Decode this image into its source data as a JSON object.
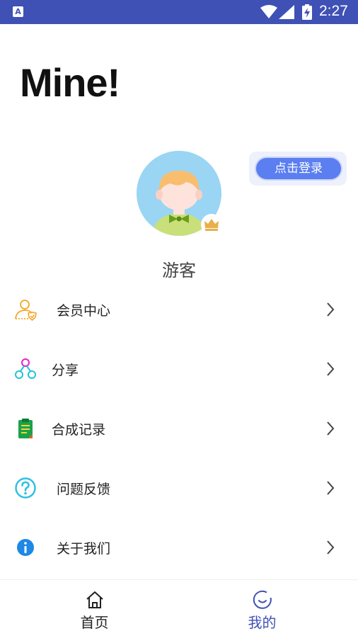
{
  "status_bar": {
    "app_icon": "A",
    "time": "2:27",
    "icons": [
      "wifi-icon",
      "signal-icon",
      "battery-charging-icon"
    ],
    "color": "#3f51b5"
  },
  "header": {
    "title": "Mine!"
  },
  "profile": {
    "login_label": "点击登录",
    "username": "游客",
    "avatar_icon": "child-avatar-icon",
    "badge_icon": "crown-icon"
  },
  "menu": {
    "items": [
      {
        "label": "会员中心",
        "icon": "member-user-icon"
      },
      {
        "label": "分享",
        "icon": "share-nodes-icon"
      },
      {
        "label": "合成记录",
        "icon": "clipboard-record-icon"
      },
      {
        "label": "问题反馈",
        "icon": "question-circle-icon"
      },
      {
        "label": "关于我们",
        "icon": "info-circle-icon"
      }
    ]
  },
  "bottom_nav": {
    "items": [
      {
        "label": "首页",
        "icon": "home-icon",
        "active": false
      },
      {
        "label": "我的",
        "icon": "smile-circle-icon",
        "active": true
      }
    ],
    "active_color": "#3f51b5"
  }
}
